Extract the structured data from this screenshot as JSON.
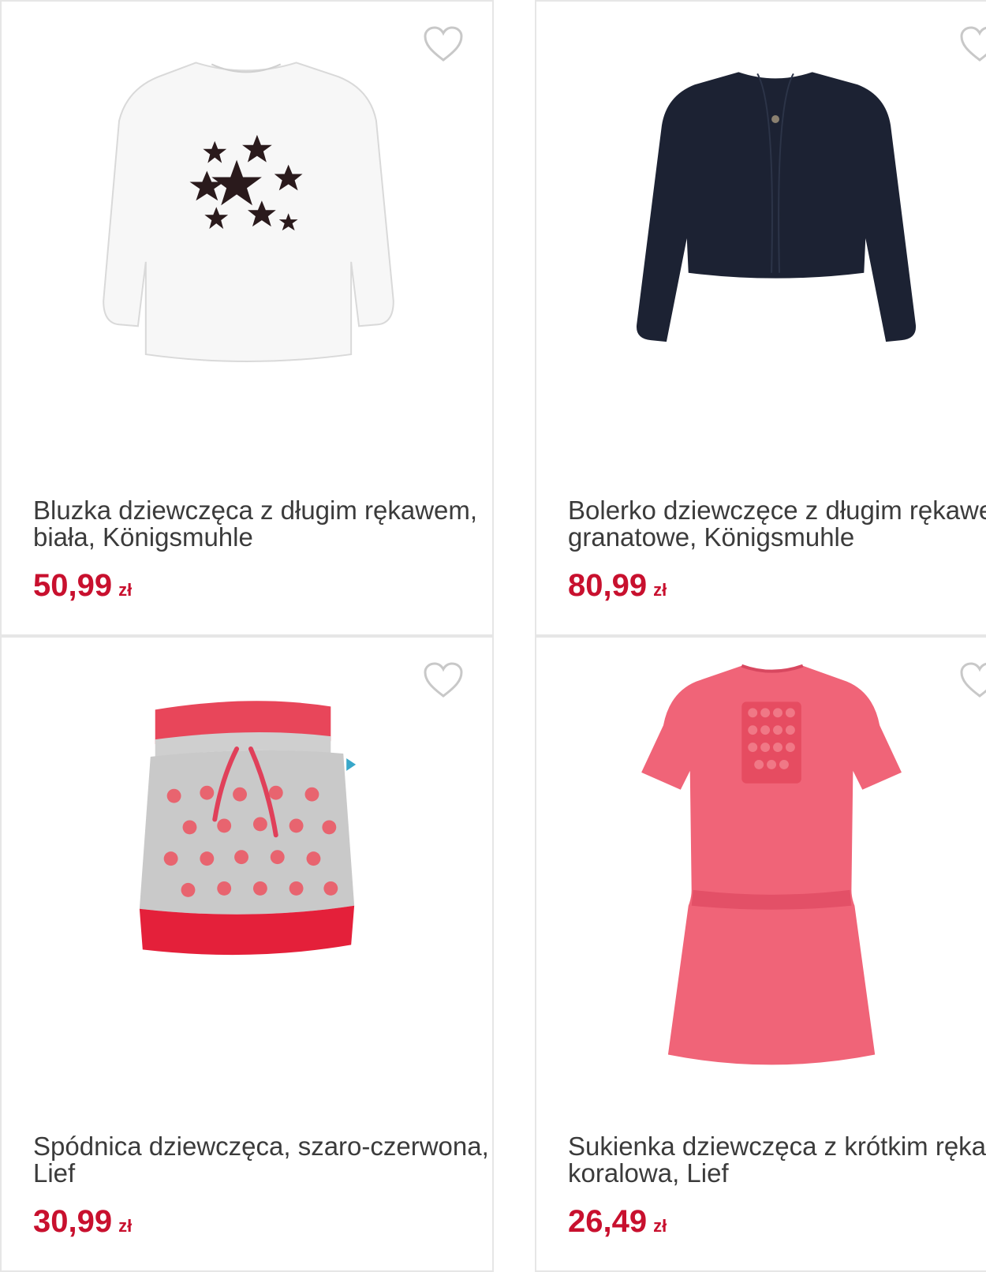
{
  "products": [
    {
      "title": "Bluzka dziewczęca z długim rękawem, biała, Königsmuhle",
      "price": "50,99",
      "currency": "zł",
      "image_icon": "white-long-sleeve-shirt-with-stars"
    },
    {
      "title": "Bolerko dziewczęce z długim rękawem, granatowe, Königsmuhle",
      "price": "80,99",
      "currency": "zł",
      "image_icon": "navy-bolero-cardigan"
    },
    {
      "title": "Spódnica dziewczęca, szaro-czerwona, Lief",
      "price": "30,99",
      "currency": "zł",
      "image_icon": "grey-red-polka-dot-skirt"
    },
    {
      "title": "Sukienka dziewczęca z krótkim rękawem, koralowa, Lief",
      "price": "26,49",
      "currency": "zł",
      "image_icon": "coral-short-sleeve-dress"
    }
  ],
  "colors": {
    "price": "#c8102e",
    "title": "#3b3b3b",
    "border": "#e6e6e6",
    "heart": "#c8c8c8"
  },
  "icons": {
    "favorite": "heart-outline-icon"
  }
}
